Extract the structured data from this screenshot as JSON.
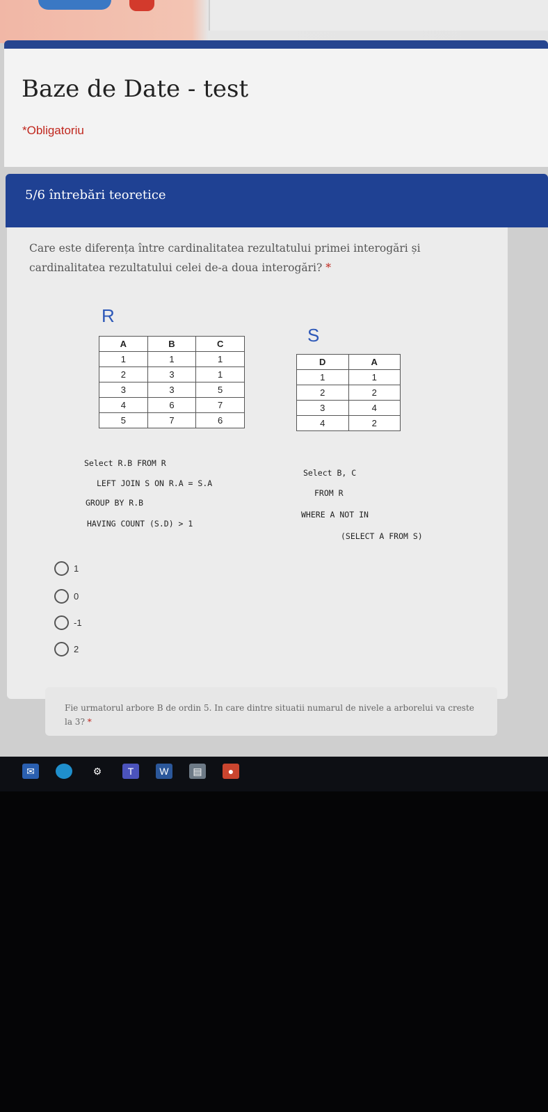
{
  "form": {
    "title": "Baze de Date - test",
    "required_note": "*Obligatoriu"
  },
  "section": {
    "label": "5/6 întrebări teoretice"
  },
  "question": {
    "text": "Care este diferența între cardinalitatea rezultatului primei interogări și cardinalitatea rezultatului celei de-a doua interogări?",
    "required_mark": "*"
  },
  "table_r": {
    "name": "R",
    "headers": [
      "A",
      "B",
      "C"
    ],
    "rows": [
      [
        "1",
        "1",
        "1"
      ],
      [
        "2",
        "3",
        "1"
      ],
      [
        "3",
        "3",
        "5"
      ],
      [
        "4",
        "6",
        "7"
      ],
      [
        "5",
        "7",
        "6"
      ]
    ]
  },
  "table_s": {
    "name": "S",
    "headers": [
      "D",
      "A"
    ],
    "rows": [
      [
        "1",
        "1"
      ],
      [
        "2",
        "2"
      ],
      [
        "3",
        "4"
      ],
      [
        "4",
        "2"
      ]
    ]
  },
  "query1": {
    "line1": "Select R.B FROM R",
    "line2": "LEFT JOIN S ON R.A = S.A",
    "line3": "GROUP BY R.B",
    "line4": "HAVING COUNT (S.D) > 1"
  },
  "query2": {
    "line1": "Select B, C",
    "line2": "FROM R",
    "line3": "WHERE A NOT IN",
    "line4": "(SELECT A FROM S)"
  },
  "options": [
    "1",
    "0",
    "-1",
    "2"
  ],
  "next_question": {
    "text": "Fie urmatorul arbore B de ordin 5. In care dintre situatii numarul de nivele a arborelui va creste la 3?",
    "required_mark": "*"
  },
  "taskbar_icons": [
    "mail-icon",
    "edge-icon",
    "settings-icon",
    "teams-icon",
    "word-icon",
    "files-icon",
    "chrome-icon"
  ]
}
